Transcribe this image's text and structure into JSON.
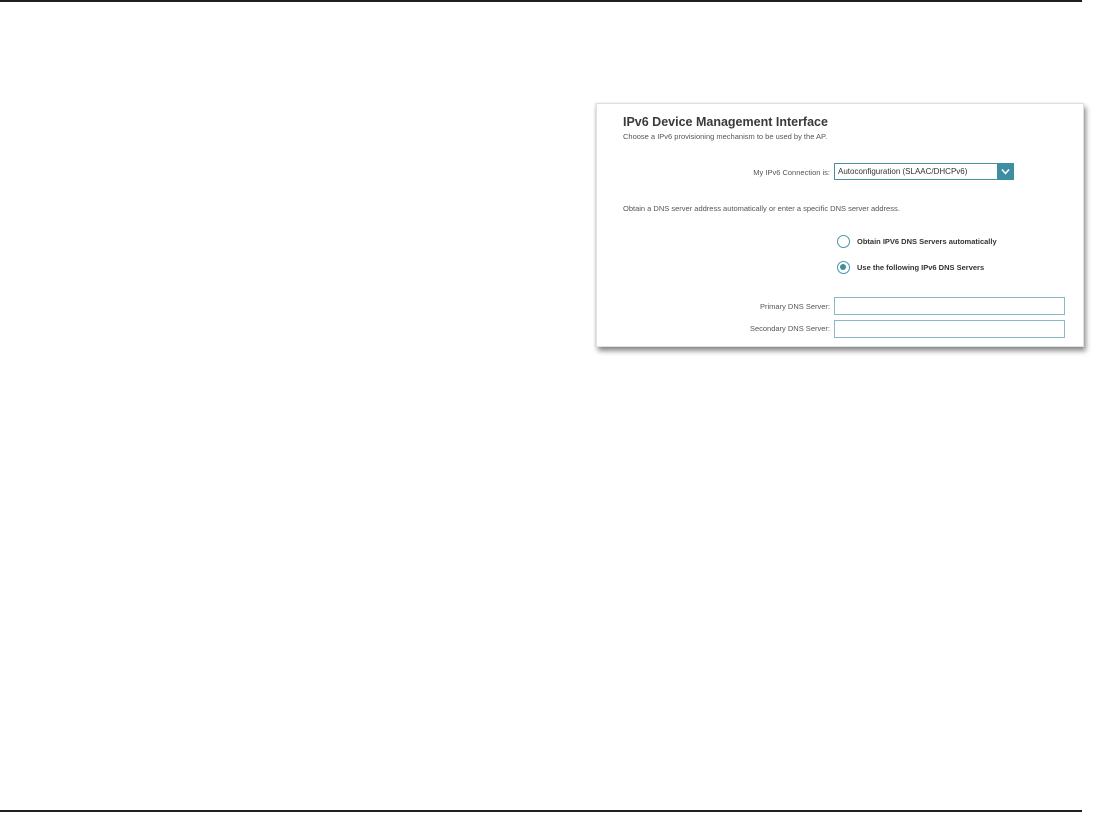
{
  "panel": {
    "title": "IPv6 Device Management Interface",
    "description": "Choose a IPv6 provisioning mechanism to be used by the AP.",
    "connection": {
      "label": "My IPv6 Connection is:",
      "selected": "Autoconfiguration (SLAAC/DHCPv6)"
    },
    "dns_description": "Obtain a DNS server address automatically or enter a specific DNS server address.",
    "radio_options": [
      {
        "label": "Obtain IPV6 DNS Servers automatically",
        "checked": false
      },
      {
        "label": "Use the following IPv6 DNS Servers",
        "checked": true
      }
    ],
    "fields": {
      "primary_dns": {
        "label": "Primary DNS Server:",
        "value": ""
      },
      "secondary_dns": {
        "label": "Secondary DNS Server:",
        "value": ""
      }
    }
  },
  "colors": {
    "accent": "#3d8ea0",
    "rule": "#231f20",
    "title": "#3a3a3a"
  },
  "icons": {
    "dropdown": "chevron-down-icon"
  }
}
